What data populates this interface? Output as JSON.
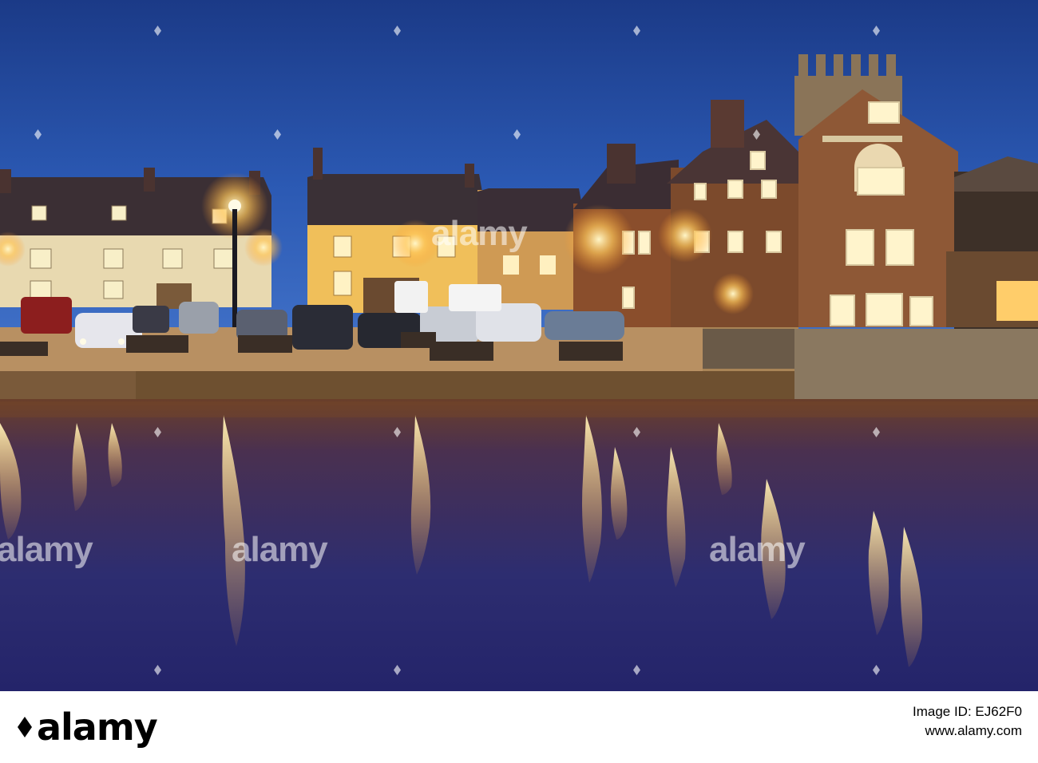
{
  "scene": {
    "subject": "harbour-town-at-dusk",
    "colors": {
      "sky_top": "#1a3c8e",
      "sky_low": "#2d5ab6",
      "water": "#2a2a6a",
      "light": "#ffc75a",
      "stone": "#b89062"
    }
  },
  "watermark": {
    "text": "alamy"
  },
  "footer": {
    "logo_text": "alamy",
    "image_id_line": "Image ID: EJ62F0",
    "site_line": "www.alamy.com"
  }
}
